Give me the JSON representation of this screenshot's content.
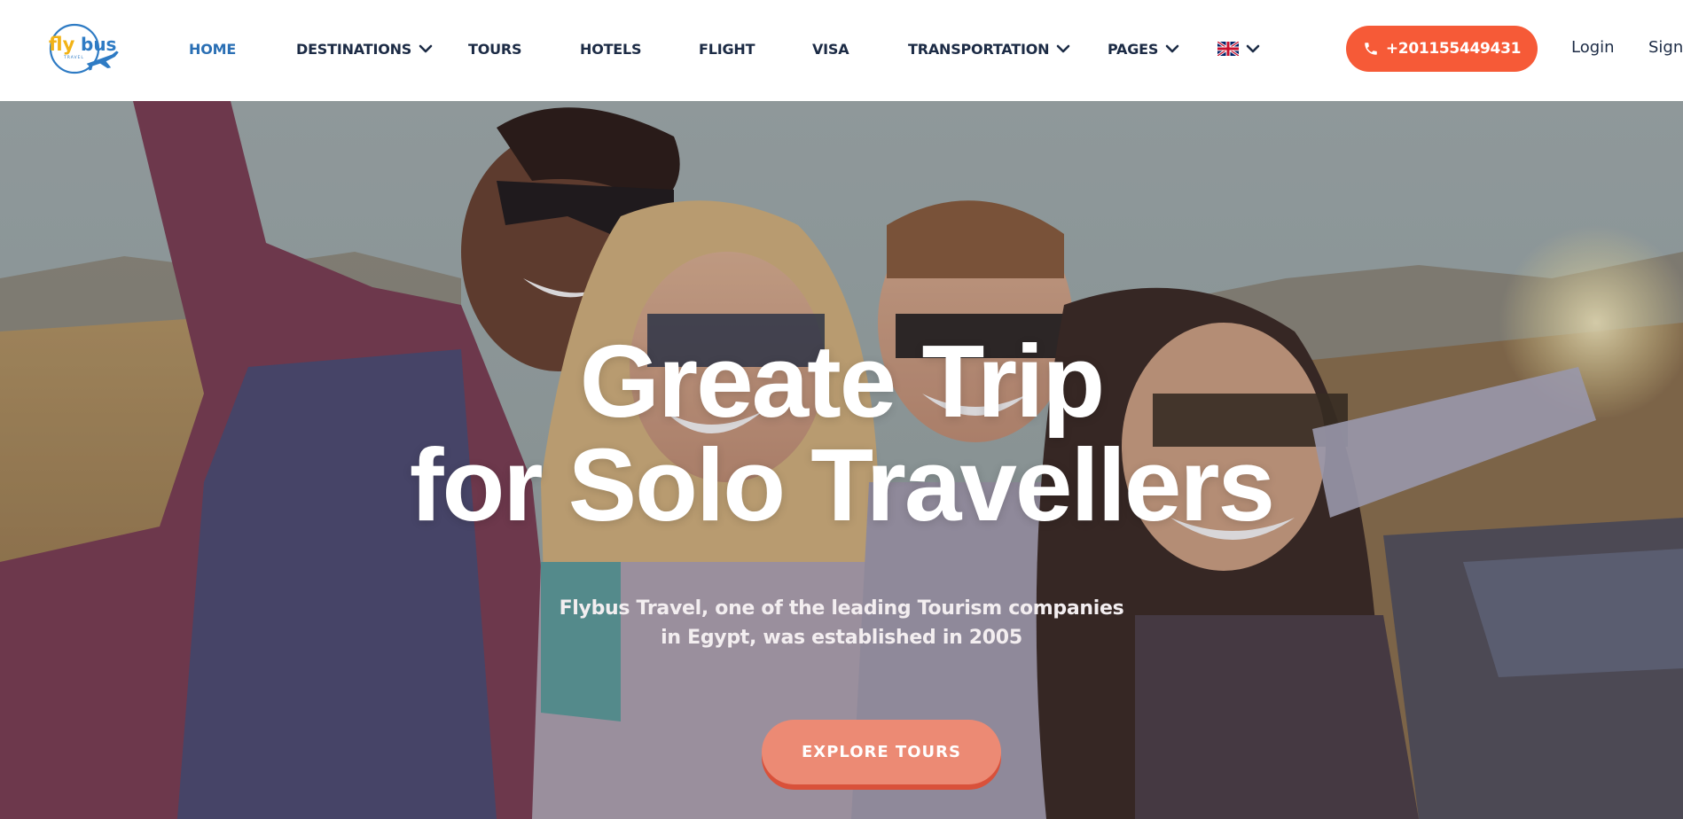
{
  "logo": {
    "text_fly": "fly",
    "text_bus": "bus",
    "text_tagline": "TRAVEL",
    "icon": "airplane-icon"
  },
  "nav": {
    "home": "HOME",
    "destinations": "DESTINATIONS",
    "tours": "TOURS",
    "hotels": "HOTELS",
    "flight": "FLIGHT",
    "visa": "VISA",
    "transportation": "TRANSPORTATION",
    "pages": "PAGES",
    "language_flag": "uk-flag-icon"
  },
  "contact": {
    "phone": "+201155449431",
    "phone_icon": "phone-icon"
  },
  "auth": {
    "login": "Login",
    "signup": "Sign"
  },
  "hero": {
    "title_line1": "Greate Trip",
    "title_line2": "for Solo Travellers",
    "subtitle_line1": "Flybus Travel, one of the leading Tourism companies",
    "subtitle_line2": "in Egypt, was established in 2005",
    "cta": "EXPLORE TOURS"
  },
  "colors": {
    "accent": "#f65a37",
    "nav_active": "#2a6fb4",
    "nav_text": "#1c2b45",
    "cta": "#ec8a74",
    "logo_yellow": "#f2b316",
    "logo_blue": "#2e7bc4"
  }
}
